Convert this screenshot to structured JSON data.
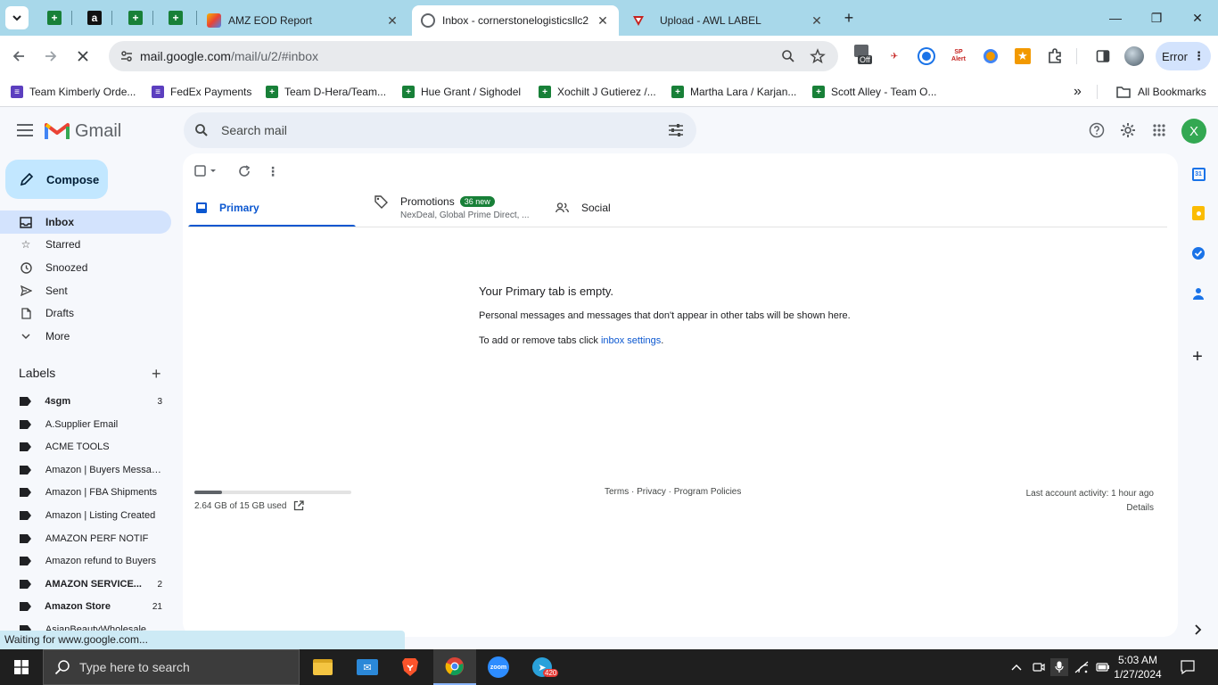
{
  "browser": {
    "tabs": [
      {
        "title": "AMZ EOD Report",
        "close": "✕"
      },
      {
        "title": "Inbox - cornerstonelogisticsllc2",
        "close": "✕"
      },
      {
        "title": "Upload - AWL LABEL",
        "close": "✕"
      }
    ],
    "new_tab": "+",
    "window": {
      "minimize": "—",
      "restore": "❐",
      "close": "✕"
    },
    "url_host": "mail.google.com",
    "url_path": "/mail/u/2/#inbox",
    "ext_off_label": "Off",
    "ext_alert_label": "Alert",
    "profile_status": "Error"
  },
  "bookmarks": [
    {
      "label": "Team Kimberly Orde...",
      "color": "#5c3fbf"
    },
    {
      "label": "FedEx Payments",
      "color": "#5c3fbf"
    },
    {
      "label": "Team D-Hera/Team...",
      "color": "#188038"
    },
    {
      "label": "Hue Grant / Sighodel",
      "color": "#188038"
    },
    {
      "label": "Xochilt J Gutierez /...",
      "color": "#188038"
    },
    {
      "label": "Martha Lara / Karjan...",
      "color": "#188038"
    },
    {
      "label": "Scott Alley - Team O...",
      "color": "#188038"
    }
  ],
  "bookmarks_more": "»",
  "all_bookmarks": "All Bookmarks",
  "gmail": {
    "logo_text": "Gmail",
    "search_placeholder": "Search mail",
    "avatar_letter": "X",
    "compose": "Compose",
    "nav": [
      {
        "label": "Inbox",
        "icon": "inbox-icon"
      },
      {
        "label": "Starred",
        "icon": "star-icon"
      },
      {
        "label": "Snoozed",
        "icon": "clock-icon"
      },
      {
        "label": "Sent",
        "icon": "send-icon"
      },
      {
        "label": "Drafts",
        "icon": "draft-icon"
      },
      {
        "label": "More",
        "icon": "chevron-down-icon"
      }
    ],
    "labels_title": "Labels",
    "labels": [
      {
        "name": "4sgm",
        "count": "3",
        "bold": true
      },
      {
        "name": "A.Supplier Email",
        "count": "",
        "bold": false
      },
      {
        "name": "ACME TOOLS",
        "count": "",
        "bold": false
      },
      {
        "name": "Amazon | Buyers Messag...",
        "count": "",
        "bold": false
      },
      {
        "name": "Amazon | FBA Shipments",
        "count": "",
        "bold": false
      },
      {
        "name": "Amazon | Listing Created",
        "count": "",
        "bold": false
      },
      {
        "name": "AMAZON PERF NOTIF",
        "count": "",
        "bold": false
      },
      {
        "name": "Amazon refund to Buyers",
        "count": "",
        "bold": false
      },
      {
        "name": "AMAZON SERVICE...",
        "count": "2",
        "bold": true
      },
      {
        "name": "Amazon Store",
        "count": "21",
        "bold": true
      },
      {
        "name": "AsianBeautyWholesale",
        "count": "",
        "bold": false
      }
    ],
    "tabs": {
      "primary": "Primary",
      "promotions": "Promotions",
      "promotions_badge": "36 new",
      "promotions_sub": "NexDeal, Global Prime Direct, ...",
      "social": "Social"
    },
    "empty": {
      "title": "Your Primary tab is empty.",
      "desc": "Personal messages and messages that don't appear in other tabs will be shown here.",
      "hint_prefix": "To add or remove tabs click ",
      "hint_link": "inbox settings",
      "hint_suffix": "."
    },
    "storage": {
      "text": "2.64 GB of 15 GB used",
      "fraction": 0.176
    },
    "footer": "Terms · Privacy · Program Policies",
    "last_activity": "Last account activity: 1 hour ago",
    "details": "Details"
  },
  "status_text": "Waiting for www.google.com...",
  "taskbar": {
    "search_placeholder": "Type here to search",
    "telegram_badge": "420",
    "time": "5:03 AM",
    "date": "1/27/2024",
    "zoom_label": "zoom"
  }
}
